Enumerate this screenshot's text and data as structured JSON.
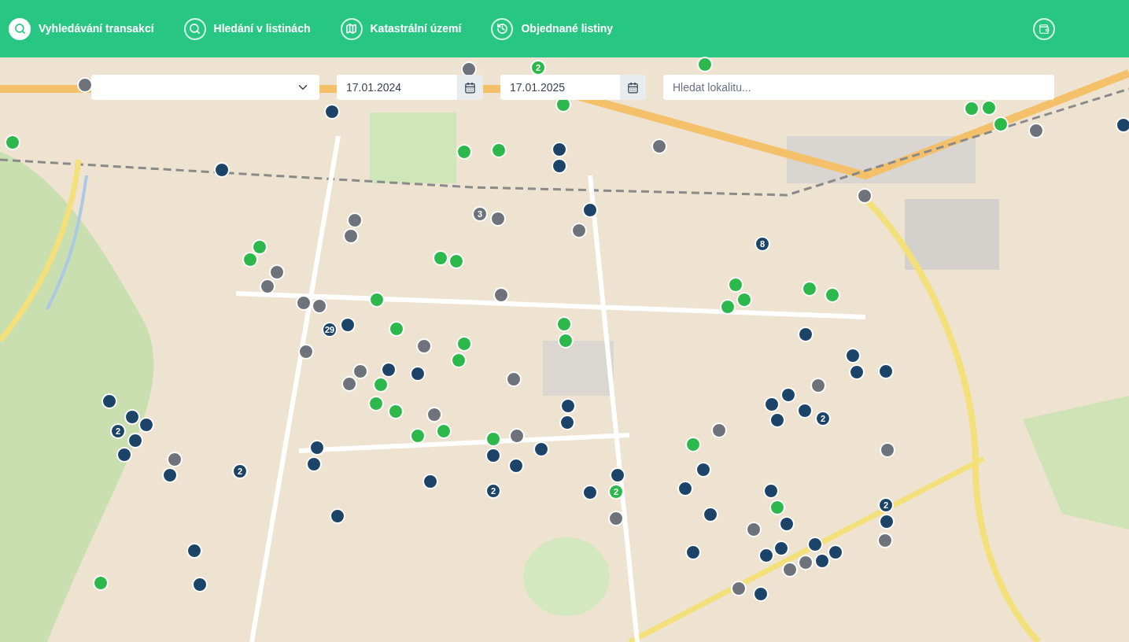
{
  "nav": [
    {
      "label": "Vyhledávání transakcí",
      "selected": true
    },
    {
      "label": "Hledání v listinách",
      "selected": false
    },
    {
      "label": "Katastrální území",
      "selected": false
    },
    {
      "label": "Objednané listiny",
      "selected": false
    }
  ],
  "filters": {
    "date_from": {
      "value": "17.01.2024"
    },
    "date_to": {
      "value": "17.01.2025"
    },
    "search": {
      "placeholder": "Hledat lokalitu..."
    }
  },
  "map": {
    "markers": [
      {
        "color": "#2db84c"
      },
      {
        "color": "#1c4468"
      },
      {
        "color": "#6e737b"
      },
      {
        "color": "#1c4468"
      },
      {
        "color": "#6e737b"
      },
      {
        "color": "#2db84c",
        "count": "2"
      },
      {
        "color": "#2db84c"
      },
      {
        "color": "#2db84c"
      },
      {
        "color": "#2db84c"
      },
      {
        "color": "#2db84c"
      },
      {
        "color": "#1c4468"
      },
      {
        "color": "#1c4468"
      },
      {
        "color": "#6e737b"
      },
      {
        "color": "#2db84c"
      },
      {
        "color": "#2db84c"
      },
      {
        "color": "#2db84c"
      },
      {
        "color": "#6e737b"
      },
      {
        "color": "#1c4468"
      },
      {
        "color": "#6e737b"
      },
      {
        "color": "#1c4468"
      },
      {
        "color": "#6e737b",
        "count": "3"
      },
      {
        "color": "#6e737b"
      },
      {
        "color": "#6e737b"
      },
      {
        "color": "#6e737b"
      },
      {
        "color": "#6e737b"
      },
      {
        "color": "#1c4468",
        "count": "8"
      },
      {
        "color": "#2db84c"
      },
      {
        "color": "#2db84c"
      },
      {
        "color": "#2db84c"
      },
      {
        "color": "#2db84c"
      },
      {
        "color": "#6e737b"
      },
      {
        "color": "#6e737b"
      },
      {
        "color": "#6e737b"
      },
      {
        "color": "#2db84c"
      },
      {
        "color": "#6e737b"
      },
      {
        "color": "#6e737b"
      },
      {
        "color": "#2db84c"
      },
      {
        "color": "#2db84c"
      },
      {
        "color": "#2db84c"
      },
      {
        "color": "#2db84c"
      },
      {
        "color": "#2db84c"
      },
      {
        "color": "#1c4468"
      },
      {
        "color": "#1c4468",
        "count": "29"
      },
      {
        "color": "#2db84c"
      },
      {
        "color": "#2db84c"
      },
      {
        "color": "#2db84c"
      },
      {
        "color": "#1c4468"
      },
      {
        "color": "#6e737b"
      },
      {
        "color": "#6e737b"
      },
      {
        "color": "#2db84c"
      },
      {
        "color": "#2db84c"
      },
      {
        "color": "#1c4468"
      },
      {
        "color": "#1c4468"
      },
      {
        "color": "#1c4468"
      },
      {
        "color": "#6e737b"
      },
      {
        "color": "#6e737b"
      },
      {
        "color": "#1c4468"
      },
      {
        "color": "#1c4468"
      },
      {
        "color": "#2db84c"
      },
      {
        "color": "#6e737b"
      },
      {
        "color": "#1c4468"
      },
      {
        "color": "#1c4468"
      },
      {
        "color": "#1c4468"
      },
      {
        "color": "#1c4468",
        "count": "2"
      },
      {
        "color": "#1c4468"
      },
      {
        "color": "#1c4468"
      },
      {
        "color": "#2db84c"
      },
      {
        "color": "#2db84c"
      },
      {
        "color": "#6e737b"
      },
      {
        "color": "#1c4468"
      },
      {
        "color": "#1c4468"
      },
      {
        "color": "#1c4468"
      },
      {
        "color": "#6e737b"
      },
      {
        "color": "#1c4468"
      },
      {
        "color": "#1c4468"
      },
      {
        "color": "#1c4468"
      },
      {
        "color": "#1c4468",
        "count": "2"
      },
      {
        "color": "#2db84c"
      },
      {
        "color": "#2db84c"
      },
      {
        "color": "#2db84c"
      },
      {
        "color": "#1c4468"
      },
      {
        "color": "#6e737b"
      },
      {
        "color": "#1c4468"
      },
      {
        "color": "#6e737b"
      },
      {
        "color": "#2db84c"
      },
      {
        "color": "#6e737b"
      },
      {
        "color": "#1c4468"
      },
      {
        "color": "#1c4468"
      },
      {
        "color": "#6e737b"
      },
      {
        "color": "#1c4468"
      },
      {
        "color": "#1c4468",
        "count": "2"
      },
      {
        "color": "#1c4468"
      },
      {
        "color": "#1c4468"
      },
      {
        "color": "#1c4468"
      },
      {
        "color": "#1c4468",
        "count": "2"
      },
      {
        "color": "#1c4468"
      },
      {
        "color": "#1c4468"
      },
      {
        "color": "#2db84c",
        "count": "2"
      },
      {
        "color": "#1c4468"
      },
      {
        "color": "#1c4468"
      },
      {
        "color": "#2db84c"
      },
      {
        "color": "#1c4468",
        "count": "2"
      },
      {
        "color": "#1c4468"
      },
      {
        "color": "#1c4468"
      },
      {
        "color": "#6e737b"
      },
      {
        "color": "#1c4468"
      },
      {
        "color": "#1c4468"
      },
      {
        "color": "#6e737b"
      },
      {
        "color": "#6e737b"
      },
      {
        "color": "#1c4468"
      },
      {
        "color": "#1c4468"
      },
      {
        "color": "#1c4468"
      },
      {
        "color": "#1c4468"
      },
      {
        "color": "#1c4468"
      },
      {
        "color": "#6e737b"
      },
      {
        "color": "#1c4468"
      },
      {
        "color": "#1c4468"
      },
      {
        "color": "#6e737b"
      },
      {
        "color": "#1c4468"
      },
      {
        "color": "#2db84c"
      },
      {
        "color": "#6e737b"
      },
      {
        "color": "#1c4468"
      }
    ]
  }
}
